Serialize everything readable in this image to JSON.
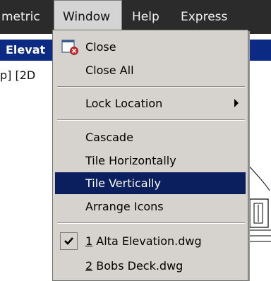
{
  "menubar": {
    "items": [
      "metric",
      "Window",
      "Help",
      "Express"
    ]
  },
  "document": {
    "title": "Elevat",
    "viewport_label": "p] [2D"
  },
  "menu": {
    "close": "Close",
    "close_all": "Close All",
    "lock_location": "Lock Location",
    "cascade": "Cascade",
    "tile_horizontally": "Tile Horizontally",
    "tile_vertically": "Tile Vertically",
    "arrange_icons": "Arrange Icons",
    "recent": [
      {
        "number": "1",
        "name": " Alta Elevation.dwg",
        "checked": true
      },
      {
        "number": "2",
        "name": " Bobs Deck.dwg",
        "checked": false
      }
    ],
    "selected_item": "Tile Vertically"
  },
  "colors": {
    "menubar_bg": "#2b2b2b",
    "menu_bg": "#d6d3ce",
    "selection_bg": "#0b1f5e",
    "doc_titlebar_bg": "#0b2a84"
  },
  "icons": {
    "close": "close-window-icon",
    "check": "checkmark-icon",
    "submenu": "submenu-arrow-icon"
  }
}
